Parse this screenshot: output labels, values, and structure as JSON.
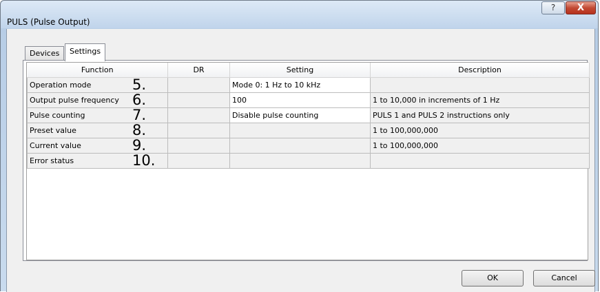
{
  "window": {
    "title": "PULS (Pulse Output)",
    "help_glyph": "?",
    "close_glyph": "X"
  },
  "tabs": [
    {
      "label": "Devices"
    },
    {
      "label": "Settings"
    }
  ],
  "table": {
    "headers": [
      "Function",
      "DR",
      "Setting",
      "Description"
    ],
    "rows": [
      {
        "function": "Operation mode",
        "number": "5.",
        "dr": "",
        "setting": "Mode 0: 1 Hz to 10 kHz",
        "description": ""
      },
      {
        "function": "Output pulse frequency",
        "number": "6.",
        "dr": "",
        "setting": "100",
        "description": "1 to 10,000 in increments of 1 Hz"
      },
      {
        "function": "Pulse counting",
        "number": "7.",
        "dr": "",
        "setting": "Disable pulse counting",
        "description": "PULS 1 and PULS 2 instructions only"
      },
      {
        "function": "Preset value",
        "number": "8.",
        "dr": "",
        "setting": "",
        "description": "1 to 100,000,000"
      },
      {
        "function": "Current value",
        "number": "9.",
        "dr": "",
        "setting": "",
        "description": "1 to 100,000,000"
      },
      {
        "function": "Error status",
        "number": "10.",
        "dr": "",
        "setting": "",
        "description": ""
      }
    ]
  },
  "buttons": {
    "ok": "OK",
    "cancel": "Cancel"
  }
}
